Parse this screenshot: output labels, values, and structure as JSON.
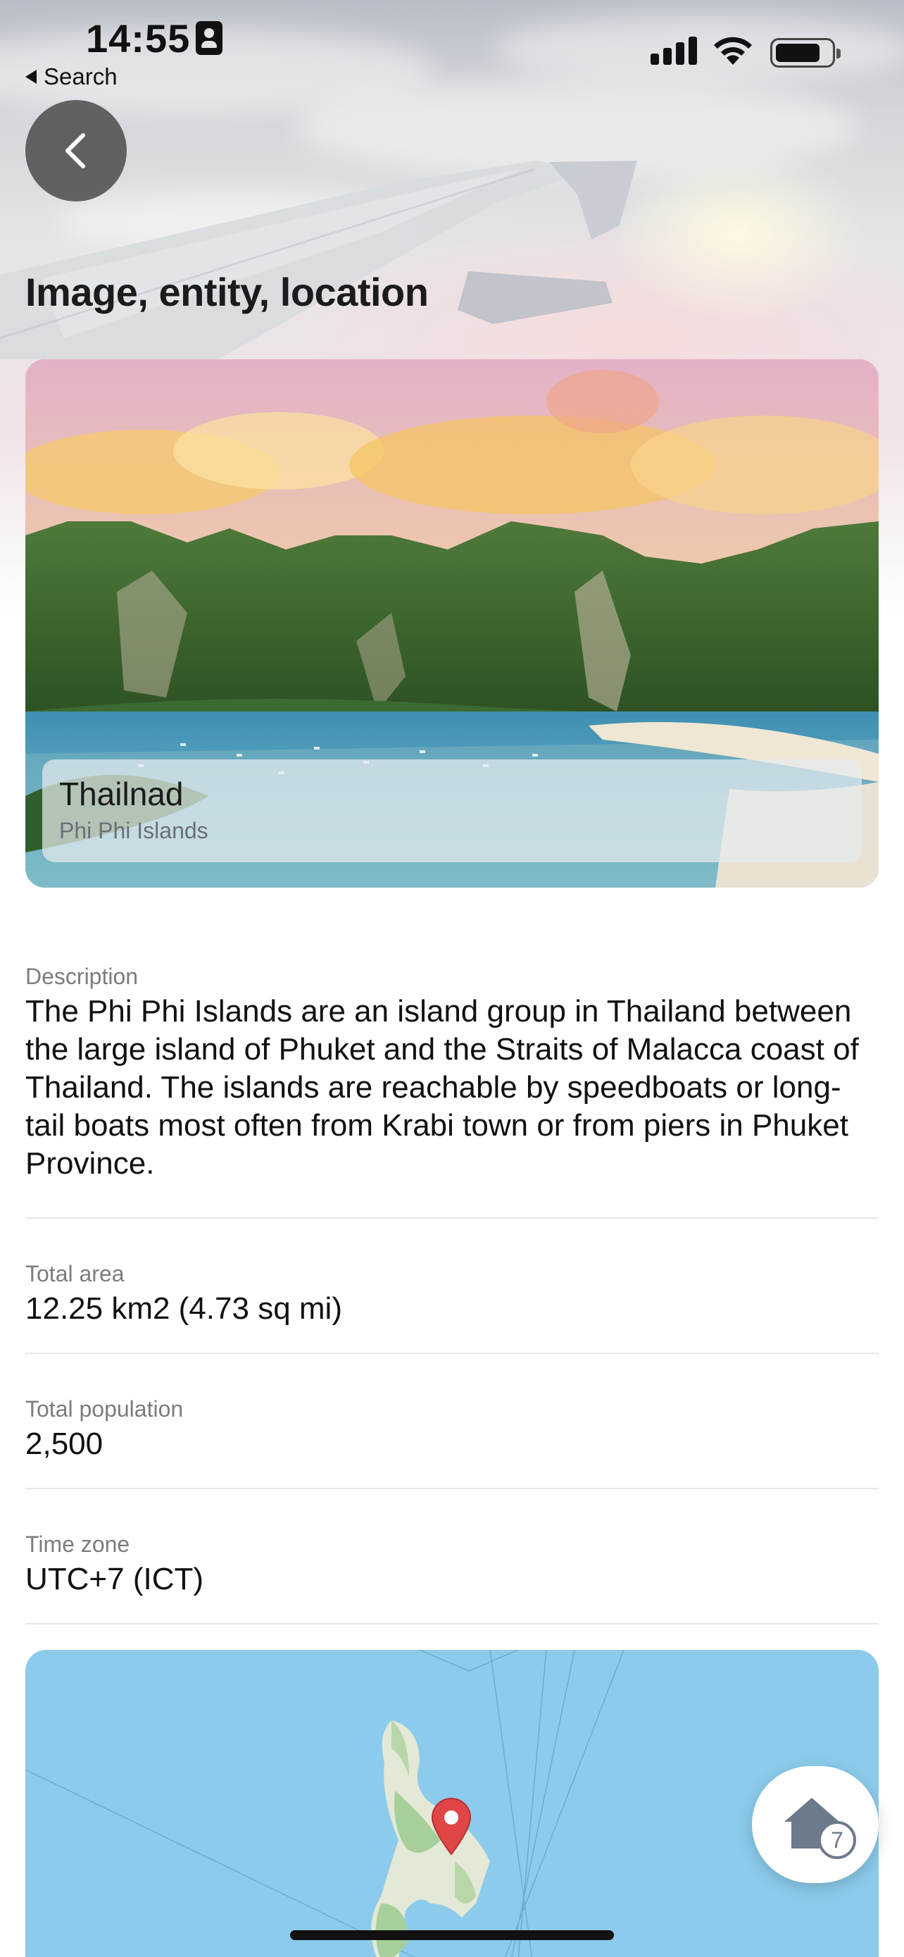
{
  "status_bar": {
    "time": "14:55",
    "back_app_label": "Search",
    "icons": [
      "contact-card-icon",
      "cellular-signal-icon",
      "wifi-icon",
      "battery-icon"
    ]
  },
  "header": {
    "back_icon": "chevron-left-icon",
    "title": "Image, entity, location"
  },
  "image_card": {
    "title": "Thailnad",
    "subtitle": "Phi Phi Islands"
  },
  "details": [
    {
      "label": "Description",
      "value": "The Phi Phi Islands are an island group in Thailand between the large island of Phuket and the Straits of Malacca coast of Thailand. The islands are reachable by speedboats or long-tail boats most often from Krabi town or from piers in Phuket Province."
    },
    {
      "label": "Total area",
      "value": "12.25 km2 (4.73 sq mi)"
    },
    {
      "label": "Total population",
      "value": "2,500"
    },
    {
      "label": "Time zone",
      "value": "UTC+7 (ICT)"
    }
  ],
  "map": {
    "marker_icon": "map-pin-icon",
    "water_color": "#8ccbeb",
    "marker_color": "#e04646"
  },
  "fab": {
    "icon": "home-icon",
    "badge_count": "7"
  }
}
